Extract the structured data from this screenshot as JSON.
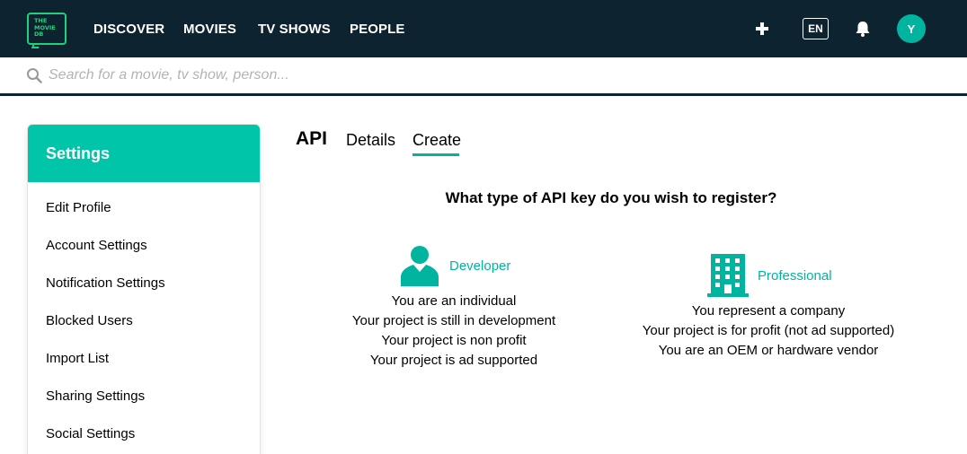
{
  "header": {
    "logo_text": "THE MOVIE DB",
    "nav": [
      "DISCOVER",
      "MOVIES",
      "TV SHOWS",
      "PEOPLE"
    ],
    "language": "EN",
    "avatar_initial": "Y",
    "icons": [
      "plus-icon",
      "bell-icon"
    ]
  },
  "search": {
    "placeholder": "Search for a movie, tv show, person..."
  },
  "sidebar": {
    "title": "Settings",
    "items": [
      {
        "label": "Edit Profile"
      },
      {
        "label": "Account Settings"
      },
      {
        "label": "Notification Settings"
      },
      {
        "label": "Blocked Users"
      },
      {
        "label": "Import List"
      },
      {
        "label": "Sharing Settings"
      },
      {
        "label": "Social Settings"
      }
    ]
  },
  "main": {
    "tabs": [
      {
        "label": "API"
      },
      {
        "label": "Details"
      },
      {
        "label": "Create"
      }
    ],
    "active_tab": "Create",
    "question": "What type of API key do you wish to register?",
    "options": [
      {
        "title": "Developer",
        "icon": "person-icon",
        "lines": [
          "You are an individual",
          "Your project is still in development",
          "Your project is non profit",
          "Your project is ad supported"
        ]
      },
      {
        "title": "Professional",
        "icon": "building-icon",
        "lines": [
          "You represent a company",
          "Your project is for profit (not ad supported)",
          "You are an OEM or hardware vendor"
        ]
      }
    ]
  },
  "colors": {
    "navbar": "#0d2330",
    "accent": "#01b4a0",
    "sidebar_header": "#01c5a9",
    "logo_green": "#21d07a"
  }
}
